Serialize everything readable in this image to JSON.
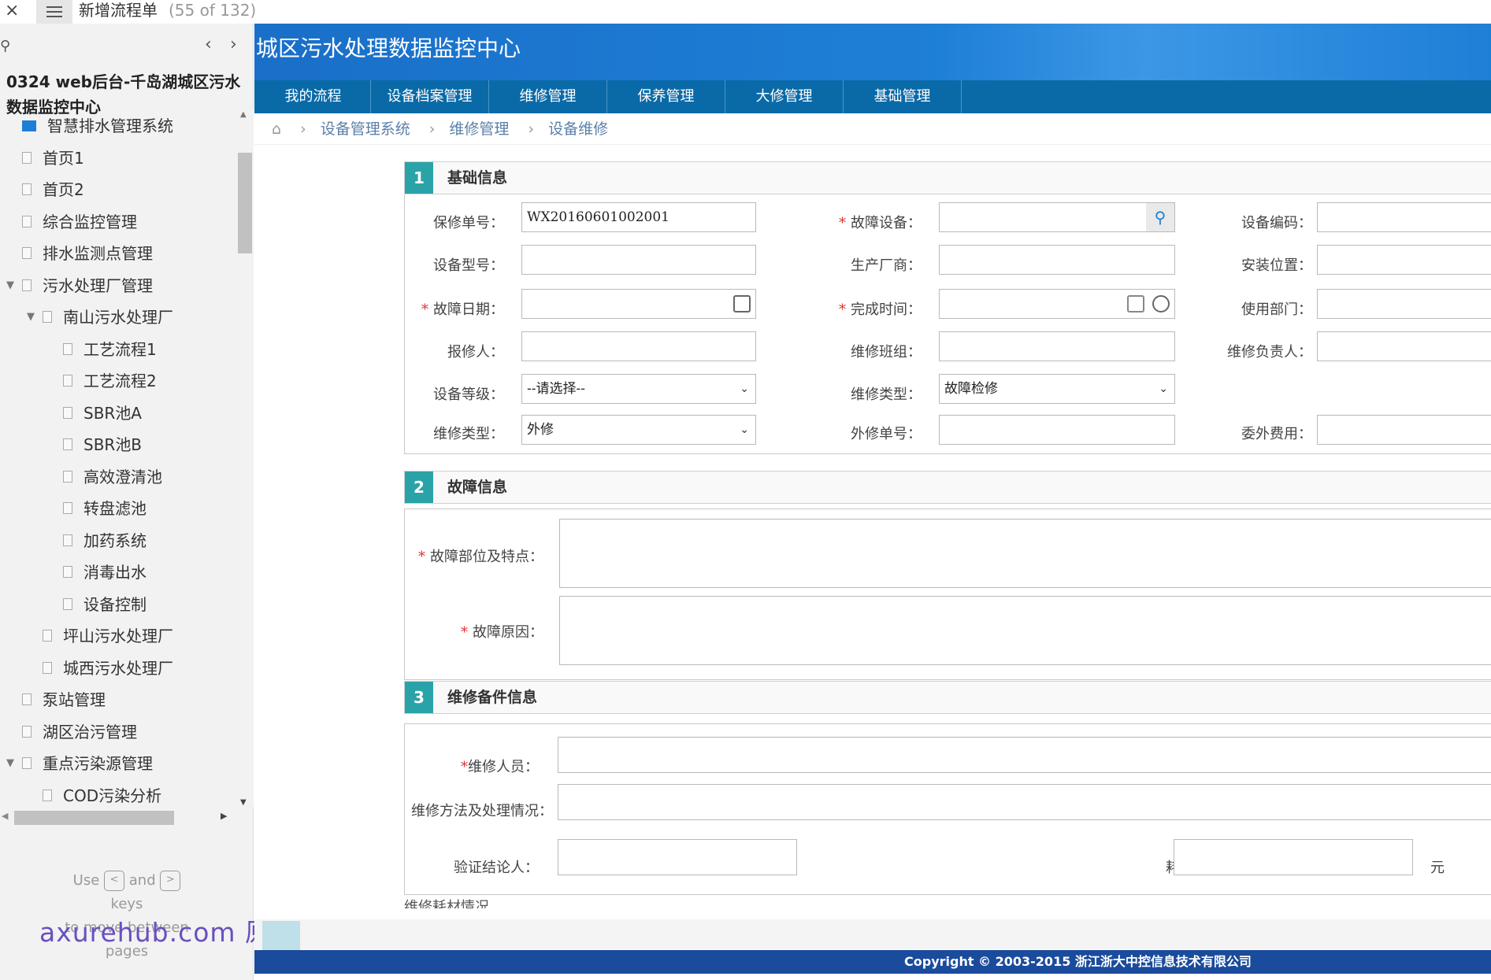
{
  "window": {
    "close": "×",
    "tab_title": "新增流程单",
    "page_count": "(55 of 132)"
  },
  "sidebar": {
    "project_title": "0324 web后台-千岛湖城区污水数据监控中心",
    "tree": [
      {
        "label": "智慧排水管理系统",
        "level": 0,
        "icon": "folder-icon",
        "toggle": ""
      },
      {
        "label": "首页1",
        "level": 0,
        "icon": "page-icon",
        "toggle": ""
      },
      {
        "label": "首页2",
        "level": 0,
        "icon": "page-icon",
        "toggle": ""
      },
      {
        "label": "综合监控管理",
        "level": 0,
        "icon": "page-icon",
        "toggle": ""
      },
      {
        "label": "排水监测点管理",
        "level": 0,
        "icon": "page-icon",
        "toggle": ""
      },
      {
        "label": "污水处理厂管理",
        "level": 0,
        "icon": "page-icon",
        "toggle": "▼"
      },
      {
        "label": "南山污水处理厂",
        "level": 1,
        "icon": "page-icon",
        "toggle": "▼"
      },
      {
        "label": "工艺流程1",
        "level": 2,
        "icon": "page-icon",
        "toggle": ""
      },
      {
        "label": "工艺流程2",
        "level": 2,
        "icon": "page-icon",
        "toggle": ""
      },
      {
        "label": "SBR池A",
        "level": 2,
        "icon": "page-icon",
        "toggle": ""
      },
      {
        "label": "SBR池B",
        "level": 2,
        "icon": "page-icon",
        "toggle": ""
      },
      {
        "label": "高效澄清池",
        "level": 2,
        "icon": "page-icon",
        "toggle": ""
      },
      {
        "label": "转盘滤池",
        "level": 2,
        "icon": "page-icon",
        "toggle": ""
      },
      {
        "label": "加药系统",
        "level": 2,
        "icon": "page-icon",
        "toggle": ""
      },
      {
        "label": "消毒出水",
        "level": 2,
        "icon": "page-icon",
        "toggle": ""
      },
      {
        "label": "设备控制",
        "level": 2,
        "icon": "page-icon",
        "toggle": ""
      },
      {
        "label": "坪山污水处理厂",
        "level": 1,
        "icon": "page-icon",
        "toggle": ""
      },
      {
        "label": "城西污水处理厂",
        "level": 1,
        "icon": "page-icon",
        "toggle": ""
      },
      {
        "label": "泵站管理",
        "level": 0,
        "icon": "page-icon",
        "toggle": ""
      },
      {
        "label": "湖区治污管理",
        "level": 0,
        "icon": "page-icon",
        "toggle": ""
      },
      {
        "label": "重点污染源管理",
        "level": 0,
        "icon": "page-icon",
        "toggle": "▼"
      },
      {
        "label": "COD污染分析",
        "level": 1,
        "icon": "page-icon",
        "toggle": ""
      }
    ],
    "hint": {
      "use": "Use",
      "and": "and",
      "keys": "keys",
      "rest": "to move between",
      "pages": "pages",
      "prev_key": "<",
      "next_key": ">"
    }
  },
  "watermark": "axurehub.com 原型资源站",
  "app": {
    "title": "城区污水处理数据监控中心",
    "nav": [
      "我的流程",
      "设备档案管理",
      "维修管理",
      "保养管理",
      "大修管理",
      "基础管理"
    ],
    "breadcrumb": [
      "设备管理系统",
      "维修管理",
      "设备维修"
    ],
    "sections": [
      {
        "num": "1",
        "title": "基础信息"
      },
      {
        "num": "2",
        "title": "故障信息"
      },
      {
        "num": "3",
        "title": "维修备件信息"
      }
    ],
    "basic": {
      "repair_no_label": "保修单号：",
      "repair_no_value": "WX20160601002001",
      "fault_device_label": "故障设备：",
      "device_code_label": "设备编码：",
      "model_label": "设备型号：",
      "maker_label": "生产厂商：",
      "location_label": "安装位置：",
      "fault_date_label": "故障日期：",
      "finish_time_label": "完成时间：",
      "dept_label": "使用部门：",
      "reporter_label": "报修人：",
      "team_label": "维修班组：",
      "leader_label": "维修负责人：",
      "grade_label": "设备等级：",
      "grade_value": "--请选择--",
      "type_label": "维修类型：",
      "type_value": "故障检修",
      "type2_label": "维修类型：",
      "type2_value": "外修",
      "outsource_no_label": "外修单号：",
      "outsource_fee_label": "委外费用："
    },
    "fault": {
      "part_label": "故障部位及特点：",
      "cause_label": "故障原因："
    },
    "parts": {
      "staff_label": "维修人员：",
      "method_label": "维修方法及处理情况：",
      "verifier_label": "验证结论人：",
      "cost_label": "耗费：",
      "unit": "元",
      "cut_label": "维修耗材情况"
    },
    "copyright": "Copyright © 2003-2015 浙江浙大中控信息技术有限公司"
  }
}
